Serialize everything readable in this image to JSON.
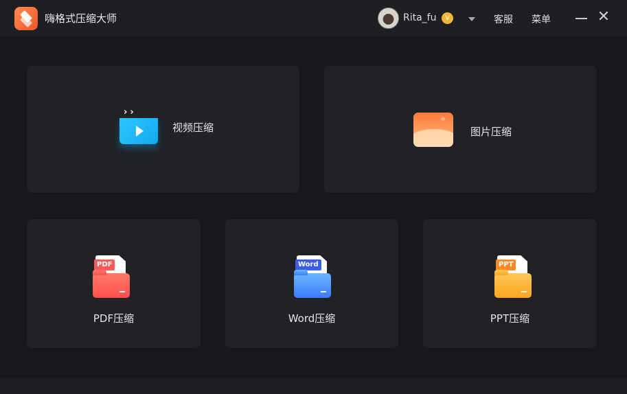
{
  "app": {
    "title": "嗨格式压缩大师"
  },
  "header": {
    "username": "Rita_fu",
    "vip_badge": "V",
    "service": "客服",
    "menu": "菜单",
    "minimize": "—",
    "close": "✕"
  },
  "cards": {
    "video": {
      "label": "视频压缩"
    },
    "image": {
      "label": "图片压缩"
    },
    "pdf": {
      "label": "PDF压缩",
      "tag": "PDF",
      "color": "#ff5a55"
    },
    "word": {
      "label": "Word压缩",
      "tag": "Word",
      "color": "#3d7bff"
    },
    "ppt": {
      "label": "PPT压缩",
      "tag": "PPT",
      "color": "#ffa520"
    }
  },
  "icons": {
    "video_arrows": "››"
  }
}
